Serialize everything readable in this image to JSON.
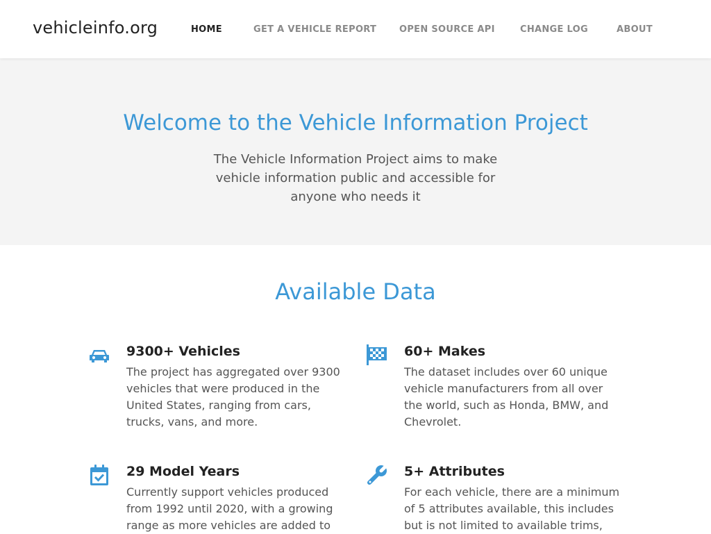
{
  "header": {
    "brand": "vehicleinfo.org",
    "nav": [
      {
        "label": "HOME",
        "active": true
      },
      {
        "label": "GET A VEHICLE REPORT",
        "active": false
      },
      {
        "label": "OPEN SOURCE API",
        "active": false
      },
      {
        "label": "CHANGE LOG",
        "active": false
      },
      {
        "label": "ABOUT",
        "active": false
      }
    ]
  },
  "hero": {
    "title": "Welcome to the Vehicle Information Project",
    "text": "The Vehicle Information Project aims to make vehicle information public and accessible for anyone who needs it"
  },
  "features": {
    "title": "Available Data",
    "items": [
      {
        "icon": "car-icon",
        "title": "9300+ Vehicles",
        "text": "The project has aggregated over 9300 vehicles that were produced in the United States, ranging from cars, trucks, vans, and more."
      },
      {
        "icon": "checkered-flag-icon",
        "title": "60+ Makes",
        "text": "The dataset includes over 60 unique vehicle manufacturers from all over the world, such as Honda, BMW, and Chevrolet."
      },
      {
        "icon": "calendar-check-icon",
        "title": "29 Model Years",
        "text": "Currently support vehicles produced from 1992 until 2020, with a growing range as more vehicles are added to"
      },
      {
        "icon": "wrench-icon",
        "title": "5+ Attributes",
        "text": "For each vehicle, there are a minimum of 5 attributes available, this includes but is not limited to available trims,"
      }
    ]
  },
  "colors": {
    "accent": "#3c98d6",
    "hero_background": "#f4f4f4",
    "nav_inactive": "#8a8a8a",
    "nav_active": "#222222"
  }
}
